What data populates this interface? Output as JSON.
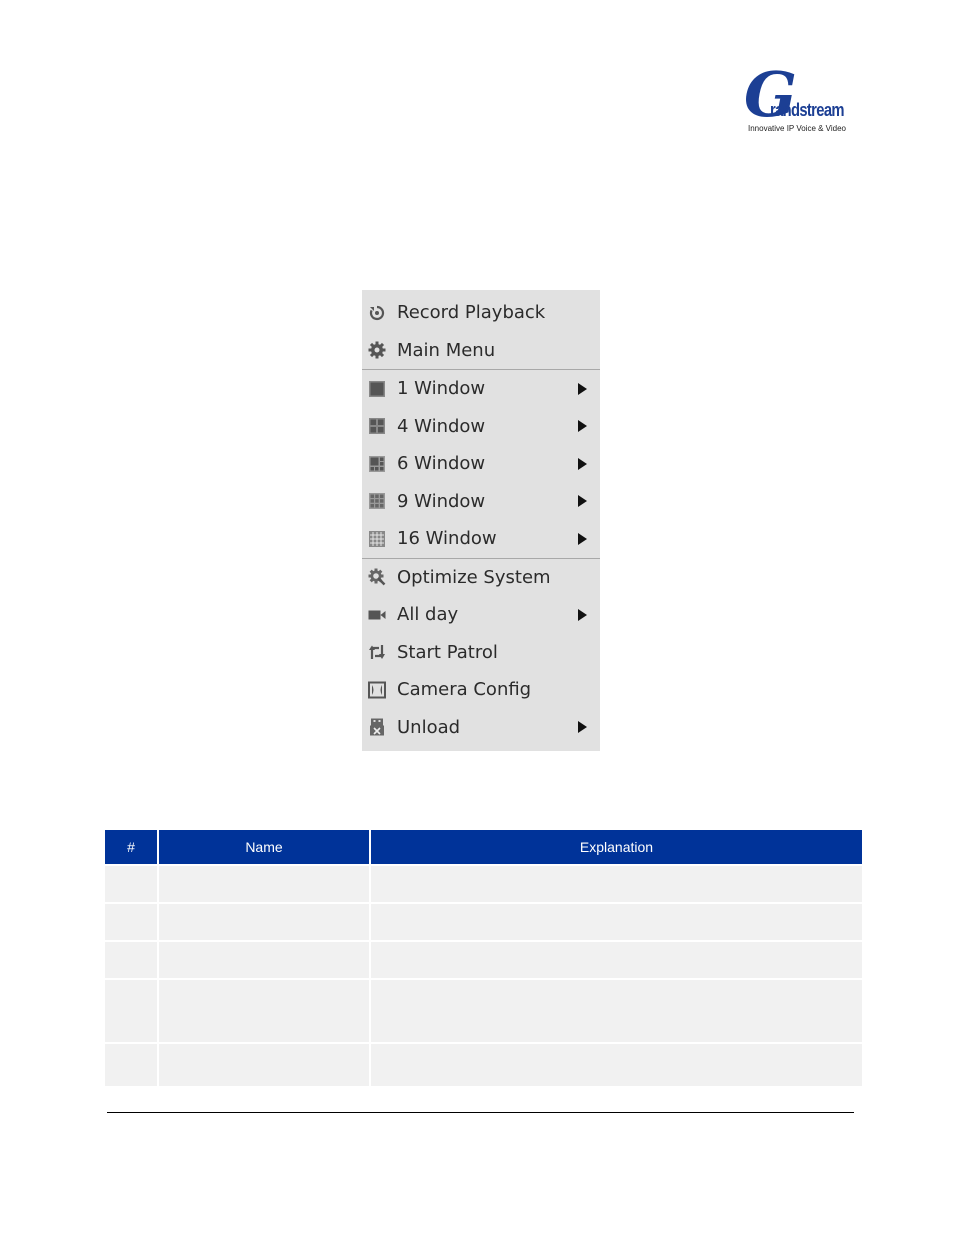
{
  "logo": {
    "initial": "G",
    "wordmark": "randstream",
    "tagline": "Innovative IP Voice & Video"
  },
  "context_menu": {
    "groups": [
      [
        {
          "label": "Record Playback",
          "icon": "record-playback-icon",
          "has_submenu": false
        },
        {
          "label": "Main Menu",
          "icon": "gear-icon",
          "has_submenu": false
        }
      ],
      [
        {
          "label": "1 Window",
          "icon": "layout-1-window-icon",
          "has_submenu": true
        },
        {
          "label": "4 Window",
          "icon": "layout-4-window-icon",
          "has_submenu": true
        },
        {
          "label": "6 Window",
          "icon": "layout-6-window-icon",
          "has_submenu": true
        },
        {
          "label": "9 Window",
          "icon": "layout-9-window-icon",
          "has_submenu": true
        },
        {
          "label": "16 Window",
          "icon": "layout-16-window-icon",
          "has_submenu": true
        }
      ],
      [
        {
          "label": "Optimize System",
          "icon": "optimize-gear-search-icon",
          "has_submenu": false
        },
        {
          "label": "All day",
          "icon": "video-camera-icon",
          "has_submenu": true
        },
        {
          "label": "Start Patrol",
          "icon": "patrol-arrows-icon",
          "has_submenu": false
        },
        {
          "label": "Camera Config",
          "icon": "camera-config-icon",
          "has_submenu": false
        },
        {
          "label": "Unload",
          "icon": "usb-unload-icon",
          "has_submenu": true
        }
      ]
    ]
  },
  "table": {
    "headers": [
      "#",
      "Name",
      "Explanation"
    ],
    "rows": [
      [
        "",
        "",
        ""
      ],
      [
        "",
        "",
        ""
      ],
      [
        "",
        "",
        ""
      ],
      [
        "",
        "",
        ""
      ],
      [
        "",
        "",
        ""
      ]
    ]
  },
  "colors": {
    "table_header_bg": "#003399",
    "table_cell_bg": "#f1f1f1",
    "menu_bg": "#e1e1e1",
    "brand_blue": "#1c3f94"
  }
}
